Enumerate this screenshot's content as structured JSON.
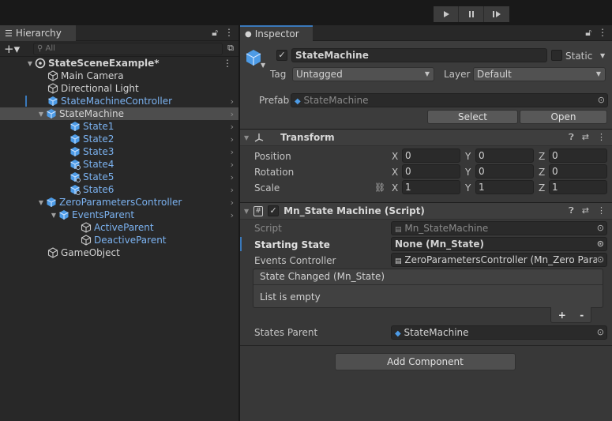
{
  "toolbar": {
    "play_icon": "play-icon",
    "pause_icon": "pause-icon",
    "step_icon": "step-icon"
  },
  "hierarchy": {
    "tab_label": "Hierarchy",
    "search_placeholder": "All",
    "scene_name": "StateSceneExample*",
    "items": [
      {
        "label": "Main Camera"
      },
      {
        "label": "Directional Light"
      },
      {
        "label": "StateMachineController"
      },
      {
        "label": "StateMachine"
      },
      {
        "label": "State1"
      },
      {
        "label": "State2"
      },
      {
        "label": "State3"
      },
      {
        "label": "State4"
      },
      {
        "label": "State5"
      },
      {
        "label": "State6"
      },
      {
        "label": "ZeroParametersController"
      },
      {
        "label": "EventsParent"
      },
      {
        "label": "ActiveParent"
      },
      {
        "label": "DeactiveParent"
      },
      {
        "label": "GameObject"
      }
    ]
  },
  "inspector": {
    "tab_label": "Inspector",
    "object_name": "StateMachine",
    "static_label": "Static",
    "tag_label": "Tag",
    "tag_value": "Untagged",
    "layer_label": "Layer",
    "layer_value": "Default",
    "prefab_label": "Prefab",
    "prefab_value": "StateMachine",
    "select_label": "Select",
    "open_label": "Open",
    "transform": {
      "title": "Transform",
      "position_label": "Position",
      "rotation_label": "Rotation",
      "scale_label": "Scale",
      "x": "X",
      "y": "Y",
      "z": "Z",
      "position": [
        "0",
        "0",
        "0"
      ],
      "rotation": [
        "0",
        "0",
        "0"
      ],
      "scale": [
        "1",
        "1",
        "1"
      ]
    },
    "script_comp": {
      "title": "Mn_State Machine (Script)",
      "script_label": "Script",
      "script_value": "Mn_StateMachine",
      "starting_state_label": "Starting State",
      "starting_state_value": "None (Mn_State)",
      "events_controller_label": "Events Controller",
      "events_controller_value": "ZeroParametersController (Mn_Zero Paran",
      "event_header": "State Changed (Mn_State)",
      "list_empty": "List is empty",
      "plus": "+",
      "minus": "-",
      "states_parent_label": "States Parent",
      "states_parent_value": "StateMachine"
    },
    "add_component_label": "Add Component"
  }
}
